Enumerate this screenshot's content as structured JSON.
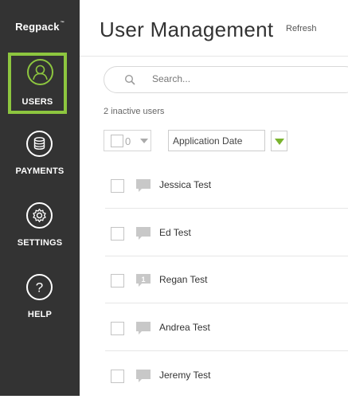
{
  "sidebar": {
    "logo": "Regpack",
    "items": [
      {
        "label": "USERS",
        "icon": "user-icon",
        "active": true
      },
      {
        "label": "PAYMENTS",
        "icon": "coins-icon",
        "active": false
      },
      {
        "label": "SETTINGS",
        "icon": "gear-icon",
        "active": false
      },
      {
        "label": "HELP",
        "icon": "question-icon",
        "active": false
      }
    ],
    "accent": "#8dc63f",
    "background": "#333333"
  },
  "header": {
    "title": "User Management",
    "refresh_label": "Refresh"
  },
  "search": {
    "placeholder": "Search..."
  },
  "status": {
    "inactive_text": "2 inactive users"
  },
  "toolbar": {
    "selected_count": "0",
    "sort_value": "Application Date"
  },
  "users": [
    {
      "name": "Jessica Test",
      "comments": ""
    },
    {
      "name": "Ed Test",
      "comments": ""
    },
    {
      "name": "Regan Test",
      "comments": "1"
    },
    {
      "name": "Andrea Test",
      "comments": ""
    },
    {
      "name": "Jeremy Test",
      "comments": ""
    }
  ]
}
